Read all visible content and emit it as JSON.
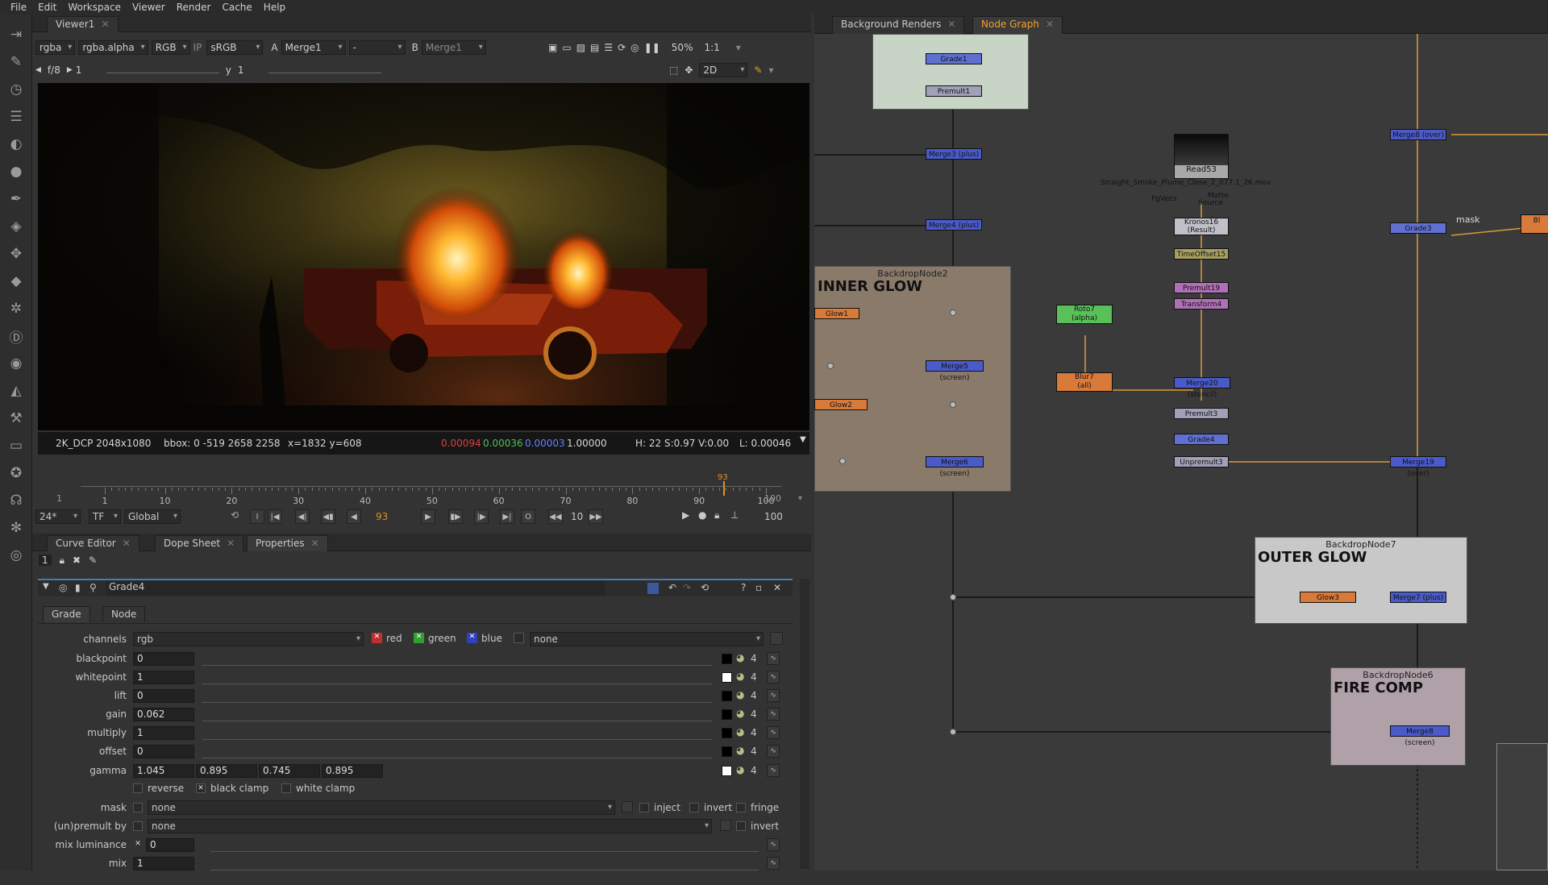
{
  "menu": [
    "File",
    "Edit",
    "Workspace",
    "Viewer",
    "Render",
    "Cache",
    "Help"
  ],
  "viewer": {
    "tab": "Viewer1",
    "channels": "rgba",
    "channel_alpha": "rgba.alpha",
    "colorspace_mode": "RGB",
    "lut": "sRGB",
    "input_a": "Merge1",
    "input_a_prefix": "A",
    "dash": "-",
    "input_b": "Merge1",
    "input_b_prefix": "B",
    "ip": "IP",
    "zoom": "50%",
    "ratio": "1:1",
    "view2d": "2D",
    "fstop": "f/8",
    "fstop_val": "1",
    "y_label": "y",
    "y_val": "1",
    "info": {
      "format": "2K_DCP 2048x1080",
      "bbox": "bbox: 0 -519 2658 2258",
      "xy": "x=1832 y=608",
      "r": "0.00094",
      "g": "0.00036",
      "b": "0.00003",
      "a": "1.00000",
      "hsv": "H: 22 S:0.97 V:0.00",
      "l": "L: 0.00046"
    }
  },
  "timeline": {
    "start": "1",
    "end": "100",
    "ticks": [
      "1",
      "10",
      "20",
      "30",
      "40",
      "50",
      "60",
      "70",
      "80",
      "90",
      "100"
    ],
    "current": "93",
    "fps": "24*",
    "tf": "TF",
    "scope": "Global",
    "frame_field": "93",
    "step": "10",
    "end_field": "100"
  },
  "panel_tabs": [
    "Curve Editor",
    "Dope Sheet",
    "Properties"
  ],
  "props": {
    "count": "1",
    "node_name": "Grade4",
    "subtabs": [
      "Grade",
      "Node"
    ],
    "channels_label": "channels",
    "channels_value": "rgb",
    "ch_red": "red",
    "ch_green": "green",
    "ch_blue": "blue",
    "ch_none": "none",
    "rows": [
      {
        "label": "blackpoint",
        "value": "0"
      },
      {
        "label": "whitepoint",
        "value": "1"
      },
      {
        "label": "lift",
        "value": "0"
      },
      {
        "label": "gain",
        "value": "0.062"
      },
      {
        "label": "multiply",
        "value": "1"
      },
      {
        "label": "offset",
        "value": "0"
      }
    ],
    "gamma_label": "gamma",
    "gamma_values": [
      "1.045",
      "0.895",
      "0.745",
      "0.895"
    ],
    "reverse": "reverse",
    "black_clamp": "black clamp",
    "white_clamp": "white clamp",
    "mask_label": "mask",
    "mask_value": "none",
    "inject": "inject",
    "invert": "invert",
    "fringe": "fringe",
    "premult_label": "(un)premult by",
    "premult_value": "none",
    "invert2": "invert",
    "mixlum_label": "mix luminance",
    "mixlum_value": "0",
    "mix_label": "mix",
    "mix_value": "1",
    "four": "4"
  },
  "graph": {
    "tabs": [
      "Background Renders",
      "Node Graph"
    ],
    "nodes": {
      "grade1": "Grade1",
      "premult1": "Premult1",
      "merge_plus1": "Merge3 (plus)",
      "merge_plus2": "Merge4 (plus)",
      "glow1": "Glow1",
      "merge_screen1": "Merge5 (screen)",
      "glow2": "Glow2",
      "merge_screen2": "Merge6 (screen)",
      "read53": "Read53",
      "read53_file": "Straight_Smoke_Plume_Close_2_077.1_2K.mov",
      "fgvecs": "FgVecs",
      "matte": "Matte",
      "source": "Source",
      "kronos": "Kronos16",
      "kronos_sub": "(Result)",
      "timeoffset": "TimeOffset15",
      "premult19": "Premult19",
      "transform4": "Transform4",
      "roto7": "Roto7",
      "roto7_sub": "(alpha)",
      "blur7": "Blur7",
      "blur7_sub": "(all)",
      "merge_stencil": "Merge20 (stencil)",
      "premult3": "Premult3",
      "grade4": "Grade4",
      "unpremult3": "Unpremult3",
      "merge_over2": "Merge19 (over)",
      "merge_over1": "Merge8 (over)",
      "grade3": "Grade3",
      "mask": "mask",
      "glow3": "Glow3",
      "merge_plus3": "Merge7 (plus)",
      "merge_screen3": "Merge8 (screen)",
      "bl": "Bl"
    },
    "backdrops": {
      "bd2_label": "BackdropNode2",
      "bd2_title": "INNER GLOW",
      "bd7_label": "BackdropNode7",
      "bd7_title": "OUTER GLOW",
      "bd6_label": "BackdropNode6",
      "bd6_title": "FIRE COMP"
    }
  }
}
